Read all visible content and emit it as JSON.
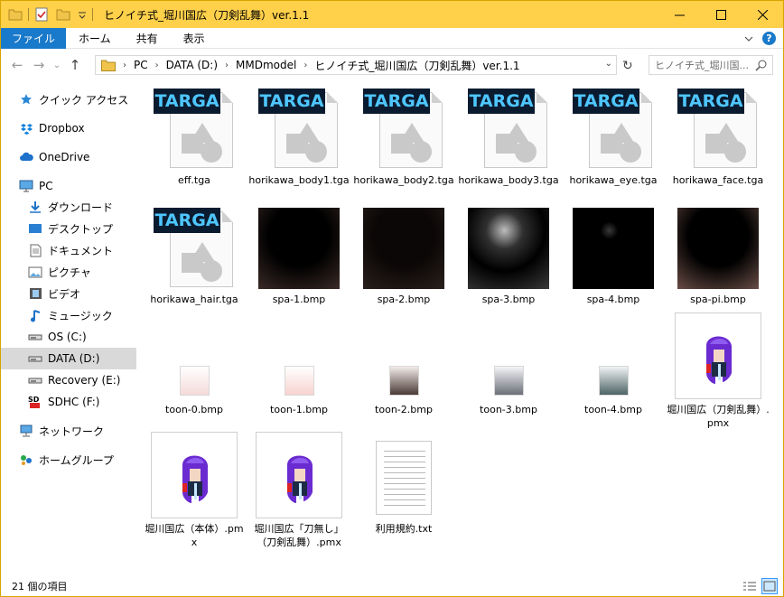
{
  "window": {
    "title": "ヒノイチ式_堀川国広（刀剣乱舞）ver.1.1",
    "accent": "#ffd04a"
  },
  "ribbon": {
    "tabs": [
      "ファイル",
      "ホーム",
      "共有",
      "表示"
    ]
  },
  "address": {
    "crumbs": [
      "PC",
      "DATA (D:)",
      "MMDmodel",
      "ヒノイチ式_堀川国広（刀剣乱舞）ver.1.1"
    ],
    "search_placeholder": "ヒノイチ式_堀川国..."
  },
  "sidebar": {
    "items": [
      {
        "label": "クイック アクセス",
        "icon": "star-icon"
      },
      {
        "label": "Dropbox",
        "icon": "dropbox-icon"
      },
      {
        "label": "OneDrive",
        "icon": "cloud-icon"
      },
      {
        "label": "PC",
        "icon": "computer-icon"
      },
      {
        "label": "ダウンロード",
        "icon": "download-icon"
      },
      {
        "label": "デスクトップ",
        "icon": "desktop-icon"
      },
      {
        "label": "ドキュメント",
        "icon": "document-icon"
      },
      {
        "label": "ピクチャ",
        "icon": "pictures-icon"
      },
      {
        "label": "ビデオ",
        "icon": "video-icon"
      },
      {
        "label": "ミュージック",
        "icon": "music-icon"
      },
      {
        "label": "OS (C:)",
        "icon": "drive-icon"
      },
      {
        "label": "DATA (D:)",
        "icon": "drive-icon"
      },
      {
        "label": "Recovery (E:)",
        "icon": "drive-icon"
      },
      {
        "label": "SDHC (F:)",
        "icon": "sd-card-icon"
      },
      {
        "label": "ネットワーク",
        "icon": "network-icon"
      },
      {
        "label": "ホームグループ",
        "icon": "homegroup-icon"
      }
    ]
  },
  "files": [
    {
      "name": "eff.tga",
      "kind": "targa",
      "badge": "TARGA"
    },
    {
      "name": "horikawa_body1.tga",
      "kind": "targa",
      "badge": "TARGA"
    },
    {
      "name": "horikawa_body2.tga",
      "kind": "targa",
      "badge": "TARGA"
    },
    {
      "name": "horikawa_body3.tga",
      "kind": "targa",
      "badge": "TARGA"
    },
    {
      "name": "horikawa_eye.tga",
      "kind": "targa",
      "badge": "TARGA"
    },
    {
      "name": "horikawa_face.tga",
      "kind": "targa",
      "badge": "TARGA"
    },
    {
      "name": "horikawa_hair.tga",
      "kind": "targa",
      "badge": "TARGA"
    },
    {
      "name": "spa-1.bmp",
      "kind": "sphere",
      "colors": [
        "#000000",
        "#3a2a26"
      ]
    },
    {
      "name": "spa-2.bmp",
      "kind": "sphere",
      "colors": [
        "#0b0706",
        "#2a201c"
      ]
    },
    {
      "name": "spa-3.bmp",
      "kind": "sphere",
      "colors": [
        "#9c9c9c",
        "#000000"
      ]
    },
    {
      "name": "spa-4.bmp",
      "kind": "sphere",
      "colors": [
        "#4a4a4a",
        "#000000"
      ]
    },
    {
      "name": "spa-pi.bmp",
      "kind": "sphere",
      "colors": [
        "#000000",
        "#6a4d45"
      ]
    },
    {
      "name": "toon-0.bmp",
      "kind": "toon",
      "colors": [
        "#ffffff",
        "#f5dada"
      ]
    },
    {
      "name": "toon-1.bmp",
      "kind": "toon",
      "colors": [
        "#ffffff",
        "#f7d3d0"
      ]
    },
    {
      "name": "toon-2.bmp",
      "kind": "toon",
      "colors": [
        "#f2ecea",
        "#4b3a36"
      ]
    },
    {
      "name": "toon-3.bmp",
      "kind": "toon",
      "colors": [
        "#f5f5f7",
        "#6b6f78"
      ]
    },
    {
      "name": "toon-4.bmp",
      "kind": "toon",
      "colors": [
        "#f0f4f4",
        "#4e6466"
      ]
    },
    {
      "name": "堀川国広（刀剣乱舞）.pmx",
      "kind": "pmx"
    },
    {
      "name": "堀川国広（本体）.pmx",
      "kind": "pmx"
    },
    {
      "name": "堀川国広「刀無し」（刀剣乱舞）.pmx",
      "kind": "pmx"
    },
    {
      "name": "利用規約.txt",
      "kind": "txt"
    }
  ],
  "status": {
    "count_text": "21 個の項目"
  }
}
